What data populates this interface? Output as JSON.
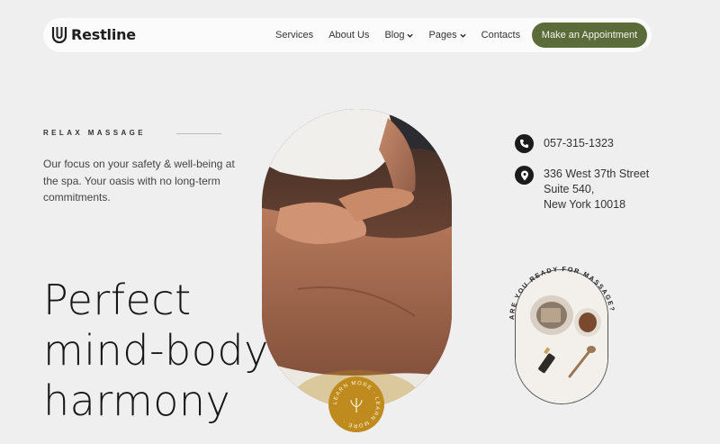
{
  "header": {
    "logo_text": "Restline",
    "nav": [
      {
        "label": "Services"
      },
      {
        "label": "About Us"
      },
      {
        "label": "Blog"
      },
      {
        "label": "Pages"
      },
      {
        "label": "Contacts"
      }
    ],
    "cta_label": "Make an Appointment"
  },
  "hero": {
    "eyebrow": "RELAX MASSAGE",
    "intro": "Our focus on your safety & well-being at the spa. Your oasis with no long-term commitments.",
    "headline": [
      "Perfect",
      "mind-body",
      "harmony"
    ],
    "badge_text": "LEARN MORE · LEARN MORE ·"
  },
  "contact": {
    "phone": "057-315-1323",
    "address": [
      "336 West 37th Street",
      "Suite 540,",
      "New York 10018"
    ]
  },
  "arch_card": {
    "circle_text": "ARE YOU READY FOR MASSAGE?"
  },
  "colors": {
    "accent_green": "#5c6b3a",
    "accent_gold": "#c08b1e",
    "background": "#efefef"
  },
  "icons": [
    "logo-mark-icon",
    "chevron-down-icon",
    "phone-icon",
    "location-pin-icon",
    "leaf-icon"
  ]
}
